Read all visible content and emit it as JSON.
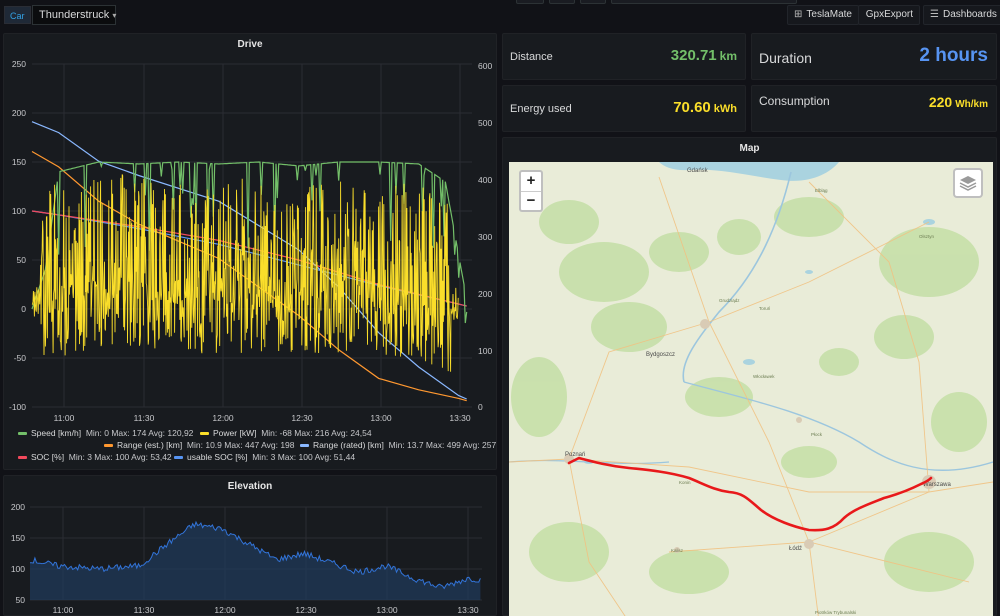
{
  "topbar": {
    "variable_label": "Car",
    "car_name": "Thunderstruck",
    "links": [
      {
        "label": "TeslaMate",
        "icon": "apps-icon"
      },
      {
        "label": "GpxExport",
        "icon": ""
      },
      {
        "label": "Dashboards",
        "icon": "menu-icon"
      }
    ]
  },
  "stats": {
    "distance": {
      "label": "Distance",
      "value": "320.71",
      "unit": "km",
      "color": "#73bf69"
    },
    "duration": {
      "label": "Duration",
      "value": "2 hours",
      "color": "#5794f2"
    },
    "energy": {
      "label": "Energy used",
      "value": "70.60",
      "unit": "kWh",
      "color": "#fade2a"
    },
    "consumption": {
      "label": "Consumption",
      "value": "220",
      "unit": "Wh/km",
      "color": "#fade2a"
    }
  },
  "drive": {
    "title": "Drive",
    "x_ticks": [
      "11:00",
      "11:30",
      "12:00",
      "12:30",
      "13:00",
      "13:30"
    ],
    "y_left_ticks": [
      "250",
      "200",
      "150",
      "100",
      "50",
      "0",
      "-50",
      "-100"
    ],
    "y_right_ticks": [
      "600",
      "500",
      "400",
      "300",
      "200",
      "100",
      "0"
    ],
    "legend": [
      {
        "name": "Speed [km/h]",
        "stats": "Min: 0   Max: 174   Avg: 120,92",
        "color": "#73bf69"
      },
      {
        "name": "Power [kW]",
        "stats": "Min: -68   Max: 216   Avg: 24,54",
        "color": "#fade2a"
      },
      {
        "name": "Range (est.) [km]",
        "stats": "Min: 10.9   Max: 447   Avg: 198",
        "color": "#ff9830"
      },
      {
        "name": "Range (rated) [km]",
        "stats": "Min: 13.7   Max: 499   Avg: 257",
        "color": "#8ab8ff"
      },
      {
        "name": "SOC [%]",
        "stats": "Min: 3   Max: 100   Avg: 53,42",
        "color": "#f2495c"
      },
      {
        "name": "usable SOC [%]",
        "stats": "Min: 3   Max: 100   Avg: 51,44",
        "color": "#5794f2"
      }
    ]
  },
  "elevation": {
    "title": "Elevation",
    "x_ticks": [
      "11:00",
      "11:30",
      "12:00",
      "12:30",
      "13:00",
      "13:30"
    ],
    "y_ticks": [
      "200",
      "150",
      "100",
      "50"
    ]
  },
  "map": {
    "title": "Map",
    "zoom_in": "+",
    "zoom_out": "−",
    "cities": [
      "Gdańsk",
      "Bydgoszcz",
      "Poznań",
      "Łódź",
      "Warszawa",
      "Płock",
      "Toruń",
      "Kalisz",
      "Konin",
      "Elbląg",
      "Olsztyn",
      "Grudziądz",
      "Włocławek",
      "Piotrków Trybunalski"
    ],
    "route_color": "#e8191b"
  },
  "chart_data": [
    {
      "type": "line",
      "title": "Drive",
      "xlabel": "",
      "ylabel": "",
      "x_range": [
        "10:50",
        "13:35"
      ],
      "ylim": [
        -100,
        250
      ],
      "y2lim": [
        0,
        600
      ],
      "series": [
        {
          "name": "Speed [km/h]",
          "axis": "left",
          "x": [
            "10:50",
            "10:55",
            "11:00",
            "11:15",
            "11:30",
            "11:45",
            "12:00",
            "12:15",
            "12:30",
            "12:45",
            "13:00",
            "13:15",
            "13:25",
            "13:33"
          ],
          "values": [
            0,
            40,
            140,
            150,
            148,
            150,
            148,
            150,
            146,
            150,
            150,
            148,
            130,
            10
          ]
        },
        {
          "name": "Power [kW]",
          "axis": "left",
          "x": [
            "10:50",
            "11:00",
            "11:15",
            "11:30",
            "11:45",
            "12:00",
            "12:15",
            "12:30",
            "12:45",
            "13:00",
            "13:15",
            "13:30"
          ],
          "values": [
            0,
            20,
            30,
            28,
            25,
            22,
            26,
            24,
            25,
            22,
            20,
            0
          ]
        },
        {
          "name": "Range (est.) [km]",
          "axis": "right",
          "x": [
            "10:50",
            "11:00",
            "11:15",
            "11:30",
            "12:00",
            "12:30",
            "12:45",
            "13:00",
            "13:15",
            "13:30",
            "13:33"
          ],
          "values": [
            447,
            420,
            360,
            320,
            260,
            160,
            100,
            50,
            30,
            15,
            11
          ]
        },
        {
          "name": "Range (rated) [km]",
          "axis": "right",
          "x": [
            "10:50",
            "11:00",
            "11:15",
            "11:30",
            "12:00",
            "12:30",
            "12:45",
            "13:00",
            "13:15",
            "13:30",
            "13:33"
          ],
          "values": [
            499,
            480,
            430,
            405,
            360,
            275,
            210,
            130,
            70,
            20,
            14
          ]
        },
        {
          "name": "SOC [%]",
          "axis": "left",
          "x": [
            "10:50",
            "11:00",
            "11:30",
            "12:00",
            "12:30",
            "13:00",
            "13:30",
            "13:33"
          ],
          "values": [
            100,
            96,
            84,
            70,
            50,
            25,
            5,
            3
          ]
        },
        {
          "name": "usable SOC [%]",
          "axis": "left",
          "x": [
            "10:50",
            "11:00",
            "11:30",
            "12:00",
            "12:30",
            "13:00",
            "13:30",
            "13:33"
          ],
          "values": [
            100,
            96,
            82,
            66,
            45,
            24,
            5,
            3
          ]
        }
      ]
    },
    {
      "type": "area",
      "title": "Elevation",
      "xlabel": "",
      "ylabel": "",
      "x_range": [
        "10:50",
        "13:35"
      ],
      "ylim": [
        50,
        200
      ],
      "series": [
        {
          "name": "Elevation",
          "x": [
            "10:50",
            "11:00",
            "11:15",
            "11:30",
            "11:40",
            "11:50",
            "12:00",
            "12:10",
            "12:20",
            "12:30",
            "12:40",
            "12:50",
            "13:00",
            "13:10",
            "13:20",
            "13:30",
            "13:35"
          ],
          "values": [
            115,
            105,
            100,
            105,
            140,
            172,
            165,
            140,
            115,
            125,
            110,
            95,
            105,
            85,
            70,
            85,
            82
          ]
        }
      ]
    }
  ]
}
